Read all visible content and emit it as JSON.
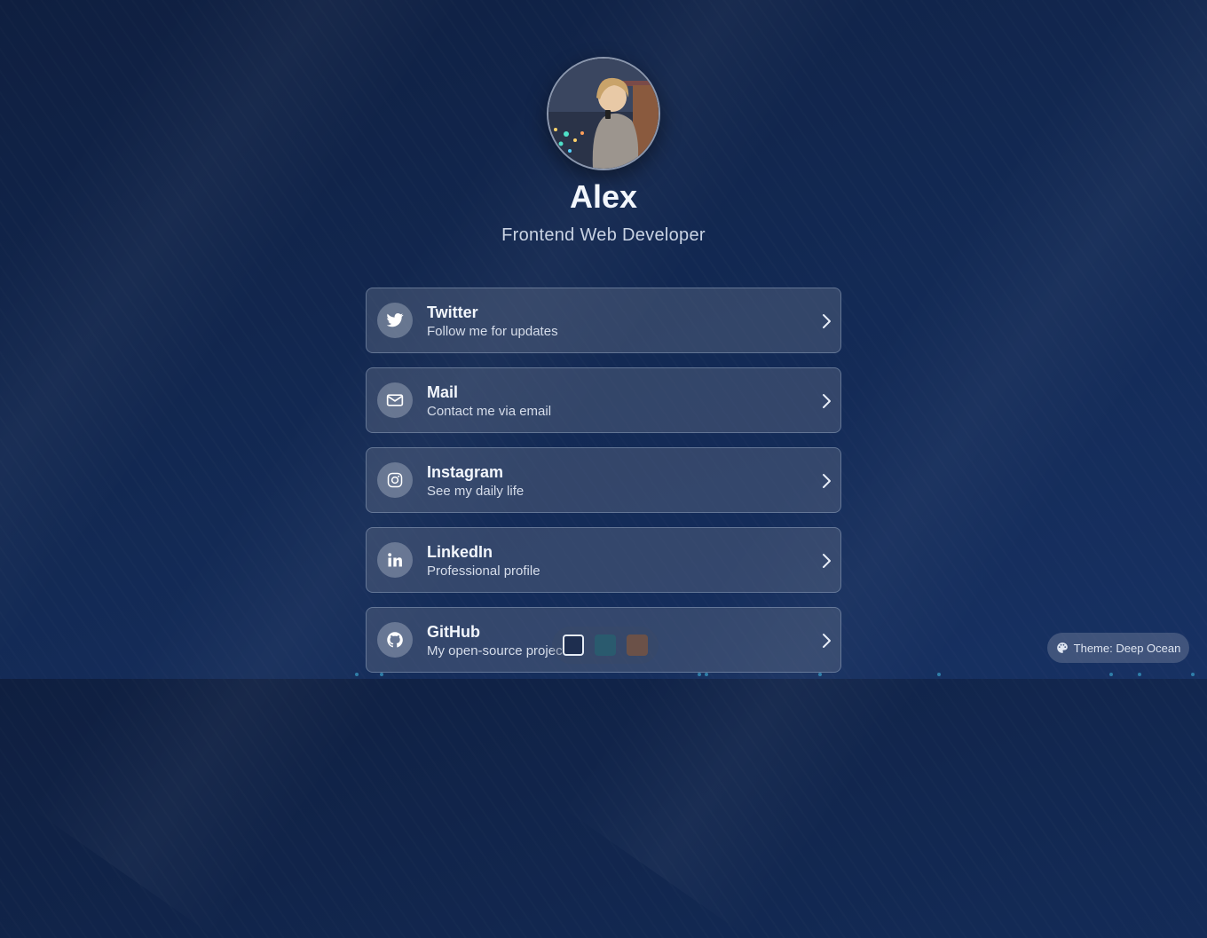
{
  "profile": {
    "name": "Alex",
    "title": "Frontend Web Developer",
    "avatar_icon": "avatar-illustration"
  },
  "links": [
    {
      "title": "Twitter",
      "description": "Follow me for updates",
      "icon": "twitter-icon"
    },
    {
      "title": "Mail",
      "description": "Contact me via email",
      "icon": "mail-icon"
    },
    {
      "title": "Instagram",
      "description": "See my daily life",
      "icon": "instagram-icon"
    },
    {
      "title": "LinkedIn",
      "description": "Professional profile",
      "icon": "linkedin-icon"
    },
    {
      "title": "GitHub",
      "description": "My open-source projects",
      "icon": "github-icon"
    }
  ],
  "theme": {
    "label": "Theme: Deep Ocean",
    "swatches": [
      {
        "name": "deep-ocean",
        "color": "#1e2e4f",
        "selected": true
      },
      {
        "name": "teal",
        "color": "#2a5a6e",
        "selected": false
      },
      {
        "name": "brown",
        "color": "#6b5148",
        "selected": false
      }
    ]
  }
}
